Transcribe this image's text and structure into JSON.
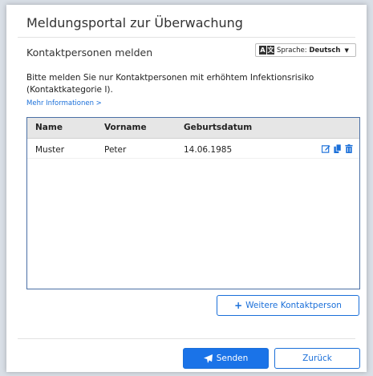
{
  "dialog": {
    "title": "Meldungsportal zur Überwachung",
    "section_title": "Kontaktpersonen melden"
  },
  "language": {
    "icon": "translate-icon",
    "icon_letters": [
      "A",
      "文"
    ],
    "label": "Sprache:",
    "selected": "Deutsch"
  },
  "info": {
    "text": "Bitte melden Sie nur Kontaktpersonen mit erhöhtem Infektionsrisiko (Kontaktkategorie I).",
    "link": "Mehr Informationen >"
  },
  "table": {
    "columns": [
      "Name",
      "Vorname",
      "Geburtsdatum"
    ],
    "rows": [
      {
        "name": "Muster",
        "vorname": "Peter",
        "geburtsdatum": "14.06.1985"
      }
    ],
    "row_actions": [
      "edit-icon",
      "copy-icon",
      "trash-icon"
    ]
  },
  "buttons": {
    "add_contact": "Weitere Kontaktperson",
    "send": "Senden",
    "back": "Zurück"
  },
  "colors": {
    "accent": "#1a73e8",
    "table_border": "#4a6fa5",
    "header_bg": "#e6e6e6"
  }
}
